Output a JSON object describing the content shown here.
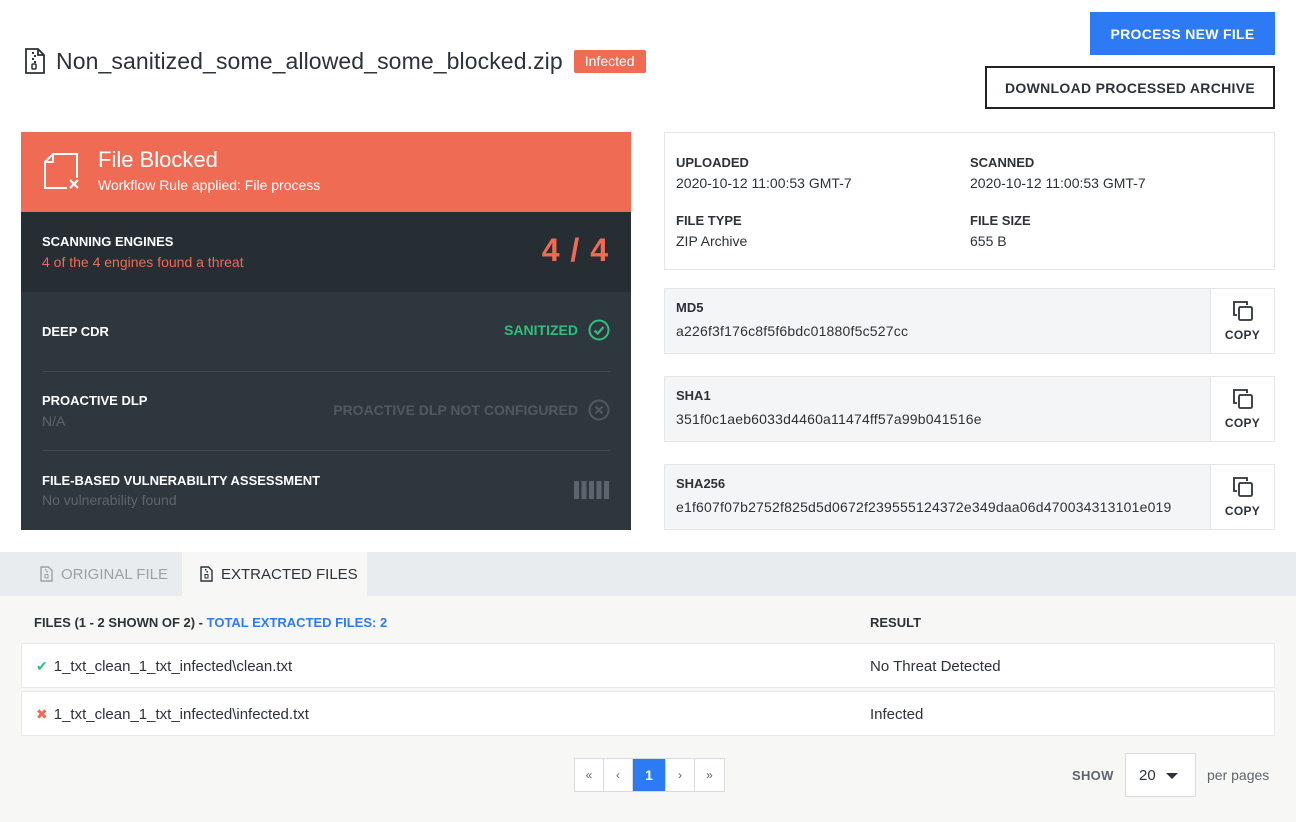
{
  "header": {
    "file_name": "Non_sanitized_some_allowed_some_blocked.zip",
    "badge": "Infected",
    "process_button": "PROCESS NEW FILE",
    "download_button": "DOWNLOAD PROCESSED ARCHIVE"
  },
  "verdict": {
    "title": "File Blocked",
    "subtitle": "Workflow Rule applied: File process",
    "color": "#ef6b54"
  },
  "engines": {
    "label": "SCANNING ENGINES",
    "subtitle": "4 of the 4 engines found a threat",
    "score": "4 / 4"
  },
  "deep_cdr": {
    "label": "DEEP CDR",
    "status": "SANITIZED",
    "status_color": "#2ec07c"
  },
  "proactive_dlp": {
    "label": "PROACTIVE DLP",
    "subtitle": "N/A",
    "status": "PROACTIVE DLP NOT CONFIGURED",
    "status_color": "#4f5961"
  },
  "vulnerability": {
    "label": "FILE-BASED VULNERABILITY ASSESSMENT",
    "subtitle": "No vulnerability found"
  },
  "info": {
    "uploaded_label": "UPLOADED",
    "uploaded_value": "2020-10-12 11:00:53 GMT-7",
    "scanned_label": "SCANNED",
    "scanned_value": "2020-10-12 11:00:53 GMT-7",
    "file_type_label": "FILE TYPE",
    "file_type_value": "ZIP Archive",
    "file_size_label": "FILE SIZE",
    "file_size_value": "655 B"
  },
  "hashes": [
    {
      "label": "MD5",
      "value": "a226f3f176c8f5f6bdc01880f5c527cc",
      "copy": "COPY"
    },
    {
      "label": "SHA1",
      "value": "351f0c1aeb6033d4460a11474ff57a99b041516e",
      "copy": "COPY"
    },
    {
      "label": "SHA256",
      "value": "e1f607f07b2752f825d5d0672f239555124372e349daa06d470034313101e019",
      "copy": "COPY"
    }
  ],
  "tabs": [
    {
      "label": "ORIGINAL FILE"
    },
    {
      "label": "EXTRACTED FILES"
    }
  ],
  "files_table": {
    "files_heading": "FILES (1 - 2 SHOWN OF 2) - ",
    "total_extracted": "TOTAL EXTRACTED FILES: 2",
    "result_heading": "RESULT",
    "rows": [
      {
        "mark": "✔",
        "mark_color": "#2ec07c",
        "name": "1_txt_clean_1_txt_infected\\clean.txt",
        "result": "No Threat Detected"
      },
      {
        "mark": "✖",
        "mark_color": "#ef6b54",
        "name": "1_txt_clean_1_txt_infected\\infected.txt",
        "result": "Infected"
      }
    ]
  },
  "pagination": {
    "first": "«",
    "prev": "‹",
    "current": "1",
    "next": "›",
    "last": "»",
    "show_label": "SHOW",
    "page_size": "20",
    "per_pages_label": "per pages"
  }
}
